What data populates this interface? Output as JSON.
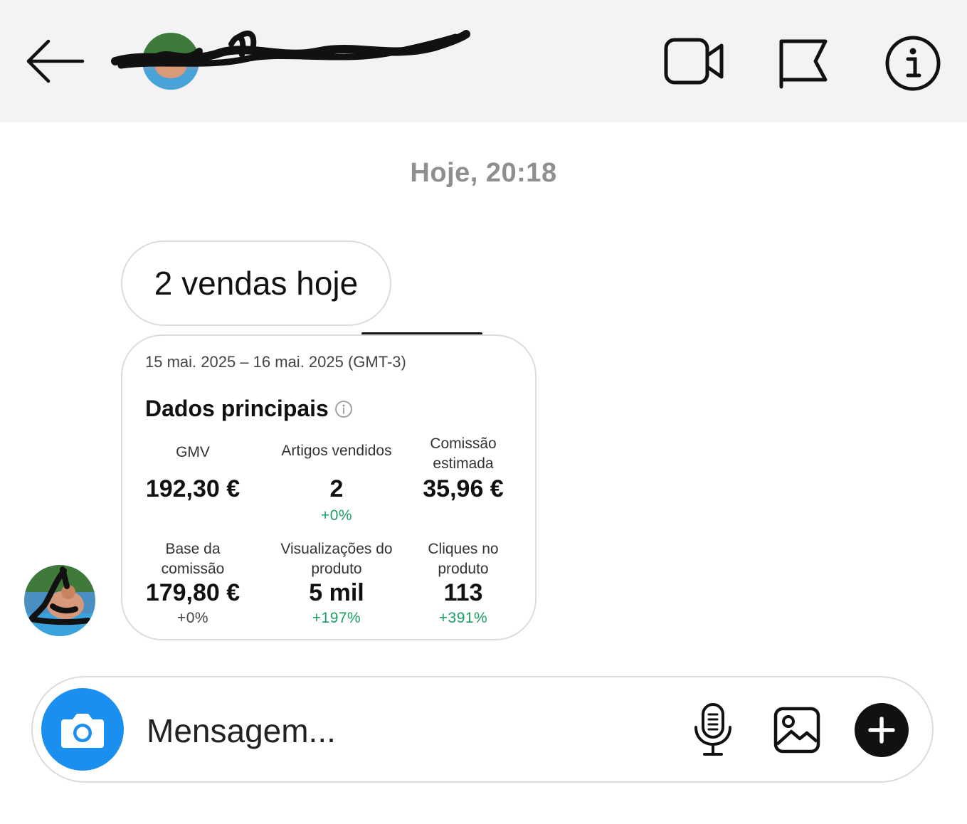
{
  "header": {
    "contact_name": "",
    "icons": [
      "arrow-left-icon",
      "video-camera-icon",
      "flag-icon",
      "info-icon"
    ]
  },
  "conversation": {
    "timestamp": "Hoje, 20:18",
    "message": "2 vendas hoje"
  },
  "card": {
    "date_range": "15 mai. 2025 – 16 mai. 2025 (GMT-3)",
    "title": "Dados principais",
    "metrics": [
      {
        "label": "GMV",
        "value": "192,30 €",
        "change": ""
      },
      {
        "label": "Artigos vendidos",
        "value": "2",
        "change": "+0%"
      },
      {
        "label": "Comissão estimada",
        "value": "35,96 €",
        "change": ""
      },
      {
        "label": "Base da comissão",
        "value": "179,80 €",
        "change": "+0%"
      },
      {
        "label": "Visualizações do produto",
        "value": "5 mil",
        "change": "+197%"
      },
      {
        "label": "Cliques no produto",
        "value": "113",
        "change": "+391%"
      }
    ]
  },
  "composer": {
    "placeholder": "Mensagem...",
    "icons": [
      "camera-icon",
      "microphone-icon",
      "image-icon",
      "plus-icon"
    ]
  },
  "colors": {
    "accent_blue": "#1a8ff0",
    "positive_green": "#1a9e63",
    "timestamp_grey": "#8f8f8f",
    "header_bg": "#f3f3f3"
  }
}
